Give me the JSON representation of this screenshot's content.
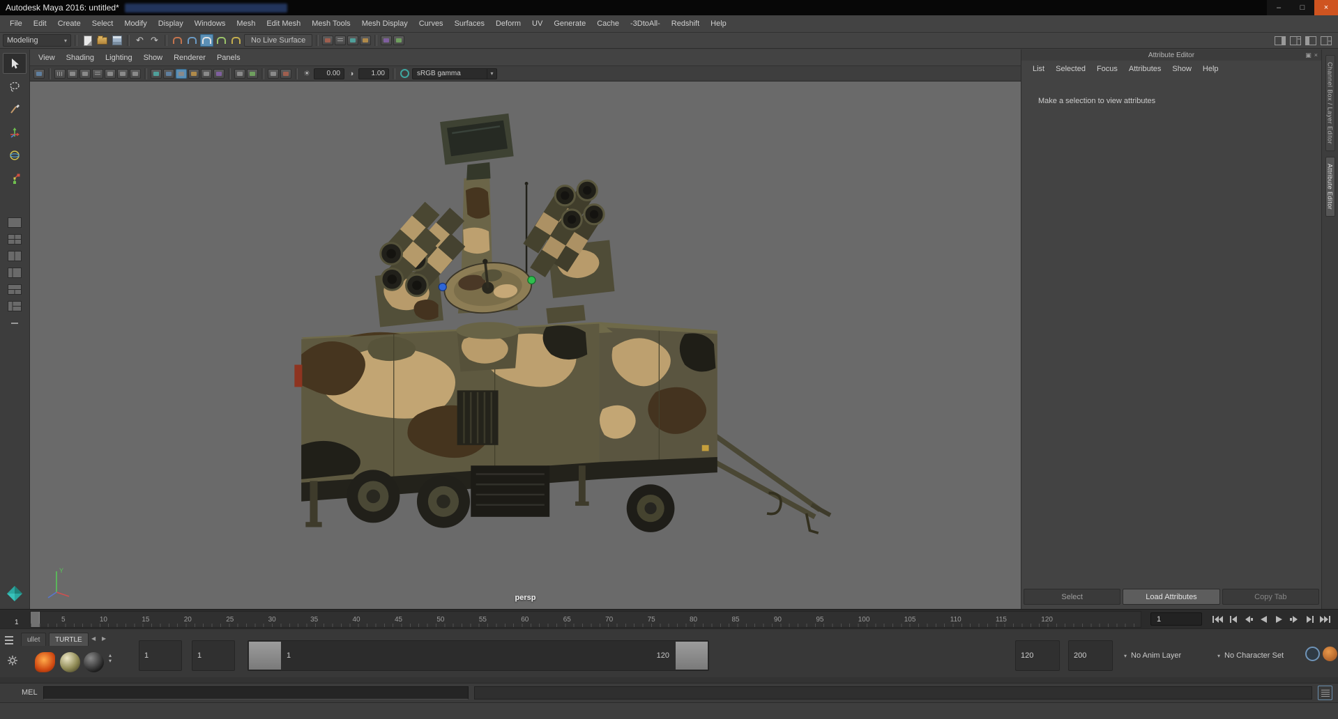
{
  "window": {
    "title": "Autodesk Maya 2016: untitled*",
    "controls": {
      "minimize": "–",
      "maximize": "□",
      "close": "×"
    }
  },
  "menu_bar": {
    "items": [
      "File",
      "Edit",
      "Create",
      "Select",
      "Modify",
      "Display",
      "Windows",
      "Mesh",
      "Edit Mesh",
      "Mesh Tools",
      "Mesh Display",
      "Curves",
      "Surfaces",
      "Deform",
      "UV",
      "Generate",
      "Cache",
      "-3DtoAll-",
      "Redshift",
      "Help"
    ]
  },
  "status_line": {
    "menu_set": "Modeling",
    "live_surface": "No Live Surface"
  },
  "panel_menu": {
    "items": [
      "View",
      "Shading",
      "Lighting",
      "Show",
      "Renderer",
      "Panels"
    ]
  },
  "viewport_toolbar": {
    "exposure": "0.00",
    "gamma": "1.00",
    "color_space": "sRGB gamma"
  },
  "viewport": {
    "camera": "persp",
    "axis_y_label": "Y"
  },
  "attribute_editor": {
    "title": "Attribute Editor",
    "menu_items": [
      "List",
      "Selected",
      "Focus",
      "Attributes",
      "Show",
      "Help"
    ],
    "placeholder": "Make a selection to view attributes",
    "footer_buttons": [
      "Select",
      "Load Attributes",
      "Copy Tab"
    ]
  },
  "side_tabs": {
    "channel_box": "Channel Box / Layer Editor",
    "attribute_editor": "Attribute Editor"
  },
  "time_slider": {
    "ticks": [
      "5",
      "10",
      "15",
      "20",
      "25",
      "30",
      "35",
      "40",
      "45",
      "50",
      "55",
      "60",
      "65",
      "70",
      "75",
      "80",
      "85",
      "90",
      "95",
      "100",
      "105",
      "110",
      "115",
      "120"
    ],
    "playhead_label": "1",
    "current_frame": "1"
  },
  "range_slider": {
    "shelf_tabs": [
      "ullet",
      "TURTLE"
    ],
    "anim_start": "1",
    "playback_start": "1",
    "range_start_label": "1",
    "range_end_label": "120",
    "playback_end": "120",
    "anim_end": "200",
    "anim_layer": "No Anim Layer",
    "character_set": "No Character Set"
  },
  "command_line": {
    "label": "MEL"
  },
  "icons": {
    "chevron_down": "▾",
    "chevron_left": "◀",
    "chevron_right": "▶",
    "undo": "↶",
    "redo": "↷",
    "dock": "▣",
    "close": "×",
    "spin_up": "▴",
    "spin_down": "▾",
    "sun": "☀",
    "contrast": "◑"
  },
  "colors": {
    "viewport_bg": "#6a6a6a",
    "panel_bg": "#434343",
    "accent_blue": "#5b8fb5",
    "close_button": "#cf5420",
    "marker_blue": "#2e66d8",
    "marker_green": "#2fbe4e"
  }
}
